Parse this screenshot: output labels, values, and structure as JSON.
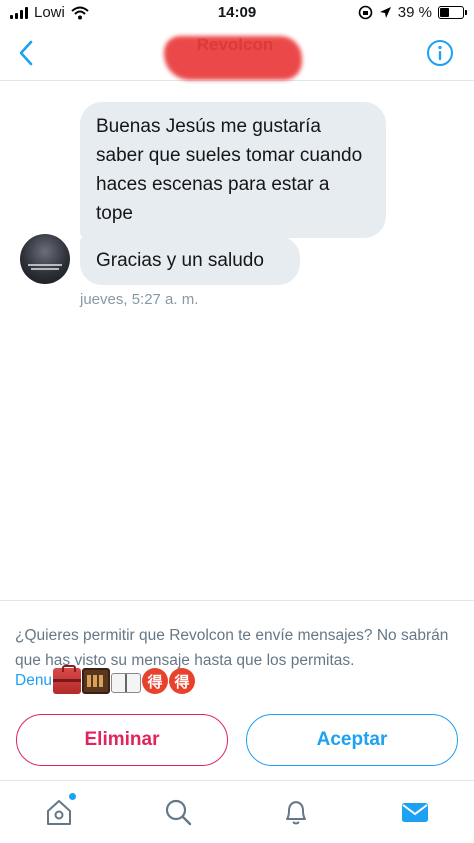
{
  "status_bar": {
    "carrier": "Lowi",
    "time": "14:09",
    "battery": "39 %",
    "battery_level": 0.39
  },
  "header": {
    "title": "Revolcon",
    "back_icon": "chevron-left-icon",
    "info_icon": "info-icon"
  },
  "conversation": {
    "messages": [
      {
        "text": "Buenas Jesús me gustaría saber que sueles tomar cuando haces escenas para estar a tope"
      },
      {
        "text": "Gracias y un saludo"
      }
    ],
    "timestamp": "jueves, 5:27 a. m."
  },
  "request": {
    "text": "¿Quieres permitir que Revolcon te envíe mensajes? No sabrán que has visto su mensaje hasta que los permitas.",
    "report_link": "Denu",
    "emoji_glyph": "得",
    "delete_label": "Eliminar",
    "accept_label": "Aceptar"
  },
  "colors": {
    "accent": "#1da1f2",
    "danger": "#e0245e",
    "bubble": "#e6ecf0",
    "secondary_text": "#657786",
    "timestamp": "#8899a6"
  },
  "tab_bar": {
    "icons": [
      "home-icon",
      "search-icon",
      "bell-icon",
      "mail-icon"
    ],
    "active": "mail-icon"
  }
}
